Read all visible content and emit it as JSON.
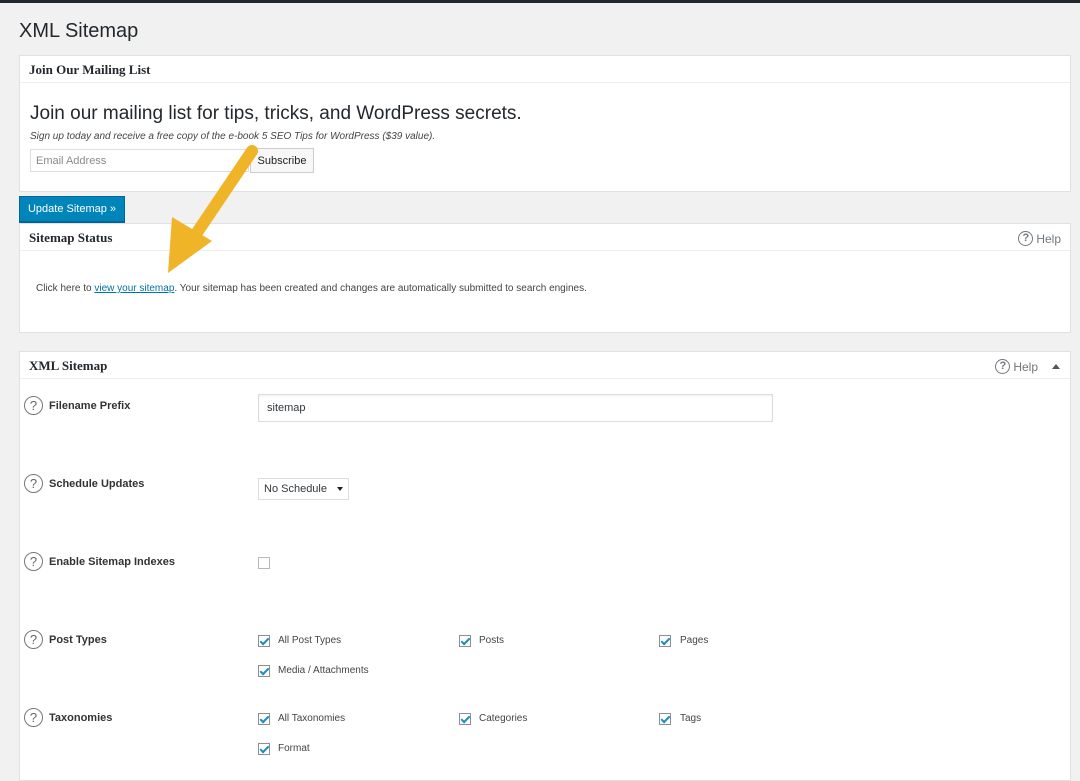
{
  "page": {
    "title": "XML Sitemap"
  },
  "mailing": {
    "box_title": "Join Our Mailing List",
    "headline": "Join our mailing list for tips, tricks, and WordPress secrets.",
    "subtext": "Sign up today and receive a free copy of the e-book 5 SEO Tips for WordPress ($39 value).",
    "email_placeholder": "Email Address",
    "email_value": "",
    "subscribe_label": "Subscribe"
  },
  "update_button": {
    "label": "Update Sitemap »"
  },
  "status": {
    "box_title": "Sitemap Status",
    "help_label": "Help",
    "text_before": "Click here to ",
    "link_text": "view your sitemap",
    "text_after": ". Your sitemap has been created and changes are automatically submitted to search engines."
  },
  "sitemap": {
    "box_title": "XML Sitemap",
    "help_label": "Help",
    "filename_prefix": {
      "label": "Filename Prefix",
      "value": "sitemap"
    },
    "schedule_updates": {
      "label": "Schedule Updates",
      "selected": "No Schedule"
    },
    "enable_indexes": {
      "label": "Enable Sitemap Indexes",
      "checked": false
    },
    "post_types": {
      "label": "Post Types",
      "options": [
        {
          "label": "All Post Types",
          "checked": true
        },
        {
          "label": "Posts",
          "checked": true
        },
        {
          "label": "Pages",
          "checked": true
        },
        {
          "label": "Media / Attachments",
          "checked": true
        }
      ]
    },
    "taxonomies": {
      "label": "Taxonomies",
      "options": [
        {
          "label": "All Taxonomies",
          "checked": true
        },
        {
          "label": "Categories",
          "checked": true
        },
        {
          "label": "Tags",
          "checked": true
        },
        {
          "label": "Format",
          "checked": true
        }
      ]
    }
  },
  "colors": {
    "accent": "#0085ba",
    "link": "#0073aa",
    "annotation_arrow": "#f0b429"
  }
}
